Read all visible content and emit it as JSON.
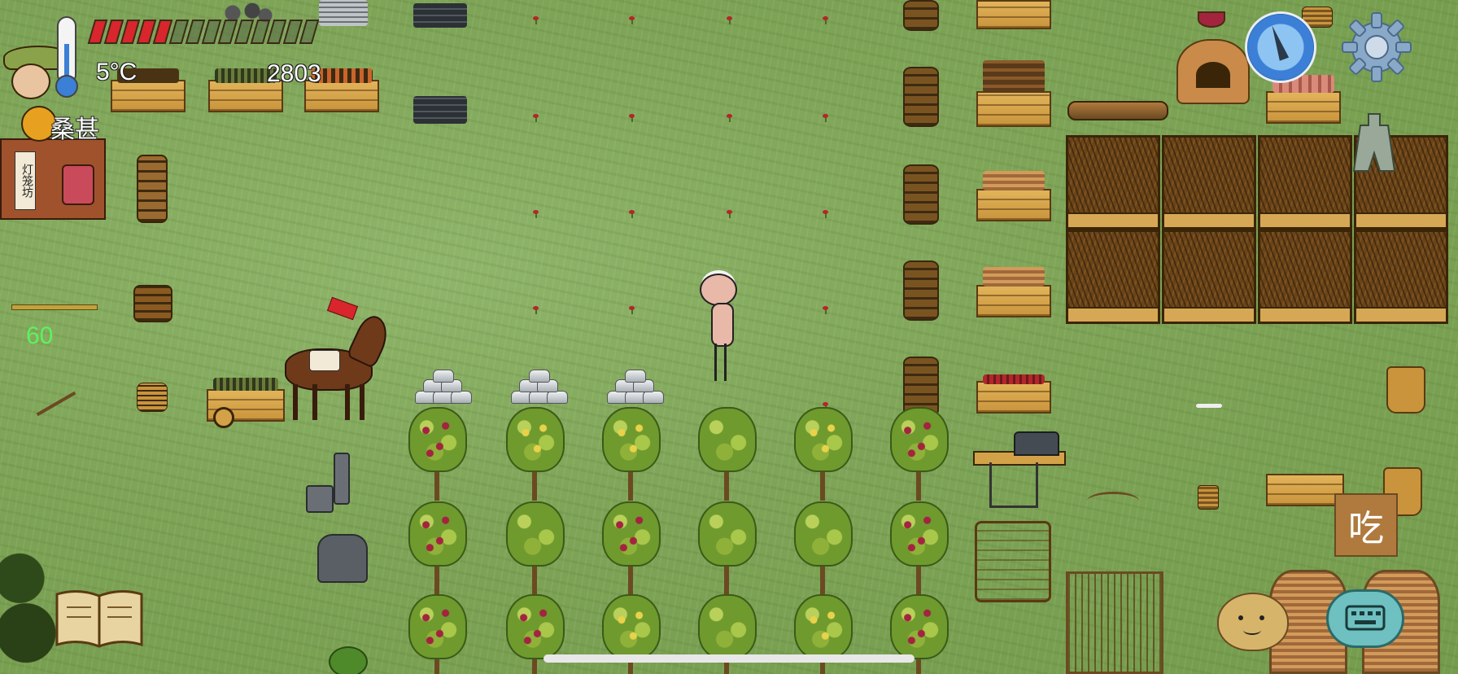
{
  "hud": {
    "temperature": "5°C",
    "counter": "2803",
    "npc_name": "桑甚",
    "shop_sign": "灯笼坊",
    "food_timer": "60",
    "eat_button_label": "吃",
    "health_segments_filled": 5,
    "health_segments_total": 14
  },
  "icons": {
    "thermometer": "thermometer-icon",
    "compass": "compass-icon",
    "settings": "gear-icon",
    "recipe_book": "book-icon",
    "emote": "potato-face-icon",
    "keyboard": "keyboard-icon",
    "coin": "ancient-spade-coin-icon"
  },
  "colors": {
    "grass": "#7ea457",
    "health_red": "#d8262c",
    "timer_green": "#5ef25e",
    "eat_button": "#b07a3e",
    "compass_blue": "#3b7fd6"
  }
}
